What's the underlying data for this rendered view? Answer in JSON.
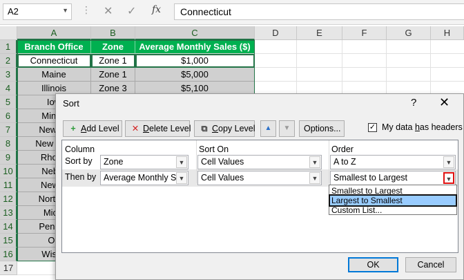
{
  "formula_bar": {
    "name_box": "A2",
    "cancel_icon": "✕",
    "enter_icon": "✓",
    "fx_label": "fx",
    "value": "Connecticut"
  },
  "sheet": {
    "columns": [
      "A",
      "B",
      "C",
      "D",
      "E",
      "F",
      "G",
      "H"
    ],
    "rows": [
      "1",
      "2",
      "3",
      "4",
      "5",
      "6",
      "7",
      "8",
      "9",
      "10",
      "11",
      "12",
      "13",
      "14",
      "15",
      "16",
      "17"
    ],
    "headers": [
      "Branch Office",
      "Zone",
      "Average Monthly Sales ($)"
    ],
    "data": [
      [
        "Connecticut",
        "Zone 1",
        "$1,000"
      ],
      [
        "Maine",
        "Zone 1",
        "$5,000"
      ],
      [
        "Illinois",
        "Zone 3",
        "$5,100"
      ],
      [
        "Iow",
        "",
        ""
      ],
      [
        "Minne",
        "",
        ""
      ],
      [
        "New Je",
        "",
        ""
      ],
      [
        "New Han",
        "",
        ""
      ],
      [
        "Rhode",
        "",
        ""
      ],
      [
        "Nebra",
        "",
        ""
      ],
      [
        "New Y",
        "",
        ""
      ],
      [
        "North D",
        "",
        ""
      ],
      [
        "Michi",
        "",
        ""
      ],
      [
        "Pennsy",
        "",
        ""
      ],
      [
        "Oh",
        "",
        ""
      ],
      [
        "Wisco",
        "",
        ""
      ]
    ]
  },
  "dialog": {
    "title": "Sort",
    "help": "?",
    "close": "✕",
    "toolbar": {
      "add_level_underline": "A",
      "add_level_rest": "dd Level",
      "delete_level_underline": "D",
      "delete_level_rest": "elete Level",
      "copy_level_underline": "C",
      "copy_level_rest": "opy Level",
      "options_label": "Options...",
      "up_arrow": "▲",
      "down_arrow": "▼"
    },
    "has_headers": {
      "label_pre": "My data ",
      "label_underline": "h",
      "label_post": "as headers",
      "checked": "✓"
    },
    "columns_header": {
      "column": "Column",
      "sort_on": "Sort On",
      "order": "Order"
    },
    "levels": [
      {
        "label": "Sort by",
        "column": "Zone",
        "sort_on": "Cell Values",
        "order": "A to Z"
      },
      {
        "label": "Then by",
        "column": "Average Monthly Sal",
        "sort_on": "Cell Values",
        "order": "Smallest to Largest"
      }
    ],
    "order_options": [
      "Smallest to Largest",
      "Largest to Smallest",
      "Custom List..."
    ],
    "ok_label": "OK",
    "cancel_label": "Cancel"
  },
  "colors": {
    "header_green": "#00b050",
    "selection_green": "#217346",
    "highlight_red": "#e01010",
    "list_selected": "#99ccff"
  }
}
